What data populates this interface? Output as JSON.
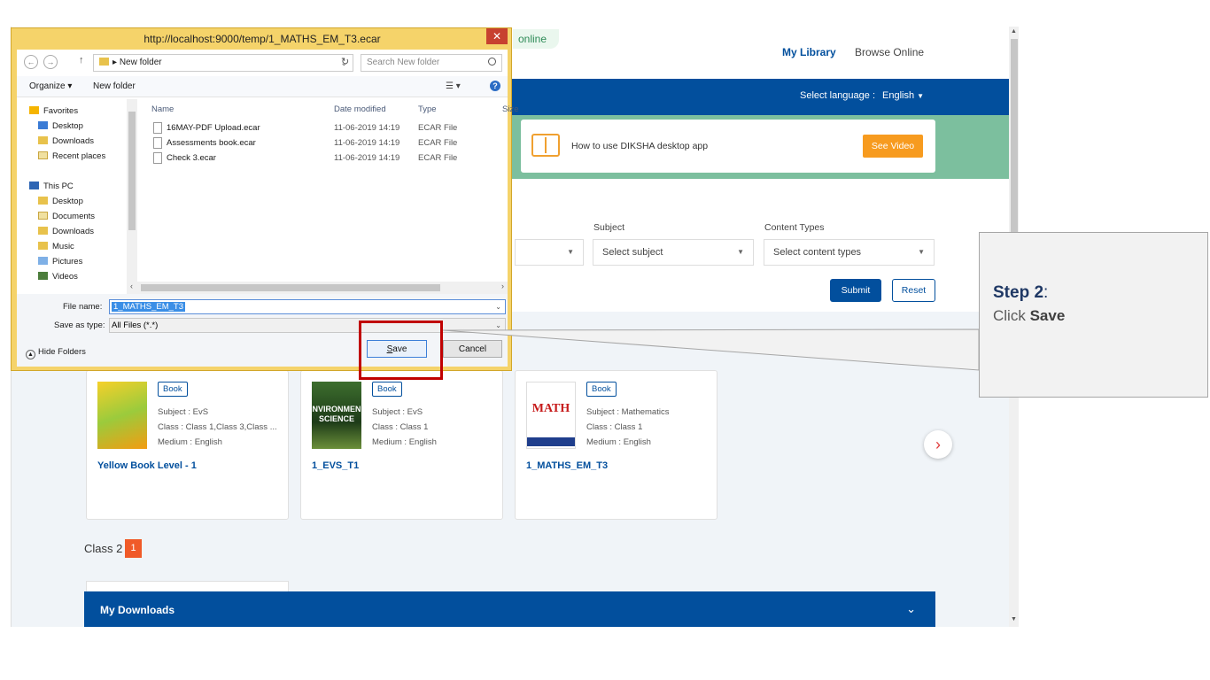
{
  "app": {
    "online_label": "online",
    "nav": {
      "my_library": "My Library",
      "browse_online": "Browse Online"
    },
    "language": {
      "label": "Select language :",
      "value": "English"
    },
    "banner": {
      "text": "How to use DIKSHA desktop app",
      "button": "See Video"
    },
    "filters": {
      "subject_label": "Subject",
      "subject_placeholder": "Select subject",
      "content_types_label": "Content Types",
      "content_types_placeholder": "Select content types",
      "submit": "Submit",
      "reset": "Reset"
    },
    "cards": [
      {
        "badge": "Book",
        "subject": "Subject : EvS",
        "class": "Class : Class 1,Class 3,Class ...",
        "medium": "Medium : English",
        "title": "Yellow Book Level - 1"
      },
      {
        "badge": "Book",
        "subject": "Subject : EvS",
        "class": "Class : Class 1",
        "medium": "Medium : English",
        "title": "1_EVS_T1",
        "thumb_text": "NVIRONMEN SCIENCE"
      },
      {
        "badge": "Book",
        "subject": "Subject : Mathematics",
        "class": "Class : Class 1",
        "medium": "Medium : English",
        "title": "1_MATHS_EM_T3",
        "thumb_text": "MATH"
      }
    ],
    "section": {
      "title": "Class 2",
      "count": "1"
    },
    "downloads": {
      "title": "My Downloads"
    }
  },
  "dialog": {
    "title": "http://localhost:9000/temp/1_MATHS_EM_T3.ecar",
    "address": "New folder",
    "search_placeholder": "Search New folder",
    "toolbar": {
      "organize": "Organize ▾",
      "new_folder": "New folder"
    },
    "nav_items": [
      {
        "label": "Favorites"
      },
      {
        "label": "Desktop"
      },
      {
        "label": "Downloads"
      },
      {
        "label": "Recent places"
      },
      {
        "label": "This PC"
      },
      {
        "label": "Desktop"
      },
      {
        "label": "Documents"
      },
      {
        "label": "Downloads"
      },
      {
        "label": "Music"
      },
      {
        "label": "Pictures"
      },
      {
        "label": "Videos"
      }
    ],
    "columns": {
      "name": "Name",
      "date": "Date modified",
      "type": "Type",
      "size": "Size"
    },
    "files": [
      {
        "name": "16MAY-PDF Upload.ecar",
        "date": "11-06-2019 14:19",
        "type": "ECAR File"
      },
      {
        "name": "Assessments book.ecar",
        "date": "11-06-2019 14:19",
        "type": "ECAR File"
      },
      {
        "name": "Check 3.ecar",
        "date": "11-06-2019 14:19",
        "type": "ECAR File"
      }
    ],
    "file_name_label": "File name:",
    "file_name_value": "1_MATHS_EM_T3",
    "save_type_label": "Save as type:",
    "save_type_value": "All Files (*.*)",
    "hide_folders": "Hide Folders",
    "save": "Save",
    "cancel": "Cancel"
  },
  "callout": {
    "step": "Step 2",
    "prefix": "Click",
    "action": "Save",
    "colors": {
      "highlight": "#c00000",
      "step": "#1f3864"
    }
  }
}
